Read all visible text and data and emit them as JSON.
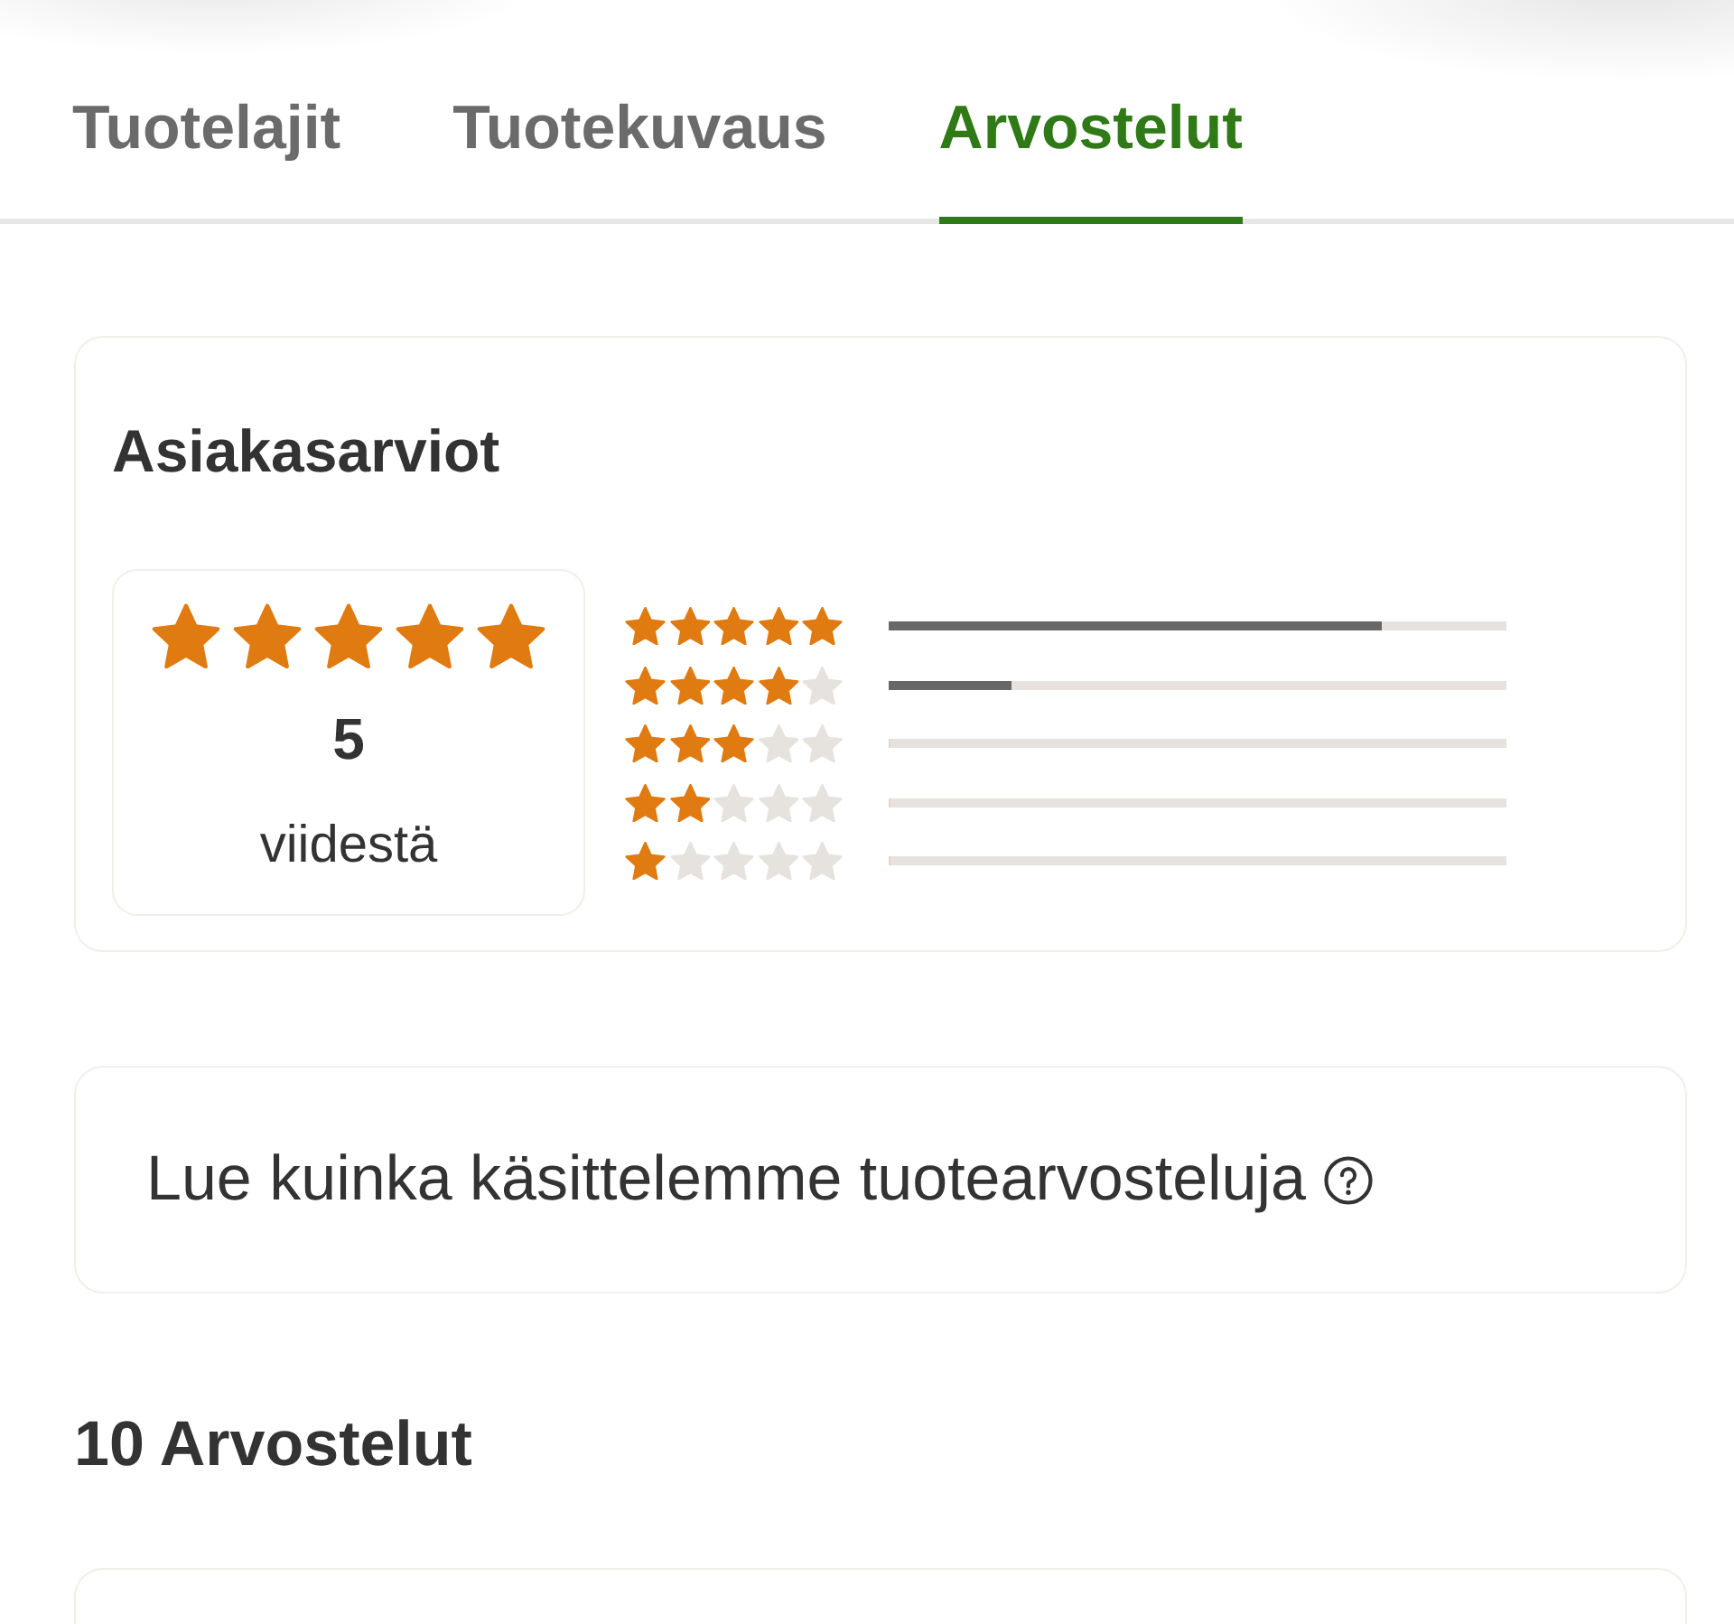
{
  "tabs": [
    {
      "label": "Tuotelajit",
      "selected": false
    },
    {
      "label": "Tuotekuvaus",
      "selected": false
    },
    {
      "label": "Arvostelut",
      "selected": true
    }
  ],
  "ratings_summary": {
    "title": "Asiakasarviot",
    "average": {
      "stars": 5,
      "score": "5",
      "caption": "viidestä"
    },
    "distribution": [
      {
        "stars": 5,
        "level": 0.8
      },
      {
        "stars": 4,
        "level": 0.2
      },
      {
        "stars": 3,
        "level": 0
      },
      {
        "stars": 2,
        "level": 0
      },
      {
        "stars": 1,
        "level": 0
      }
    ]
  },
  "policy_link": {
    "text": "Lue kuinka käsittelemme tuotearvosteluja"
  },
  "reviews": {
    "heading": "10 Arvostelut"
  }
}
